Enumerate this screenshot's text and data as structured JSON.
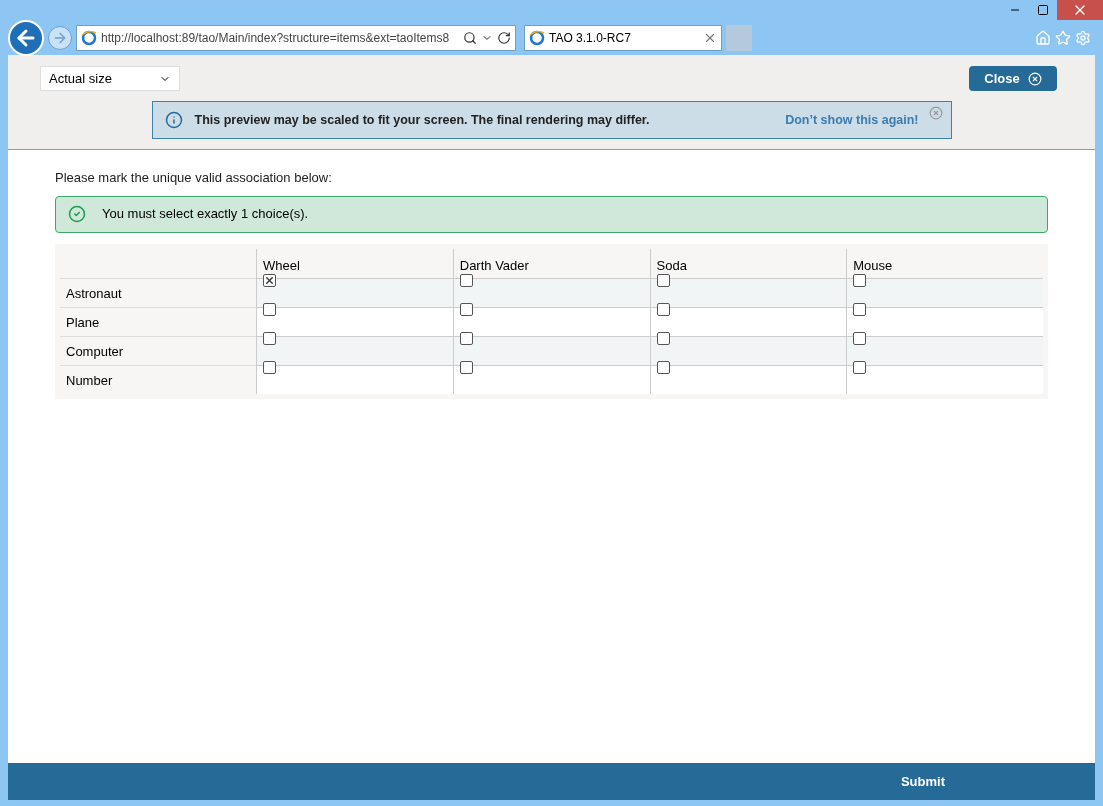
{
  "browser": {
    "url": "http://localhost:89/tao/Main/index?structure=items&ext=taoItems8",
    "tab_title": "TAO 3.1.0-RC7"
  },
  "toolbar": {
    "size_select": "Actual size",
    "close": "Close"
  },
  "notice": {
    "text": "This preview may be scaled to fit your screen. The final rendering may differ.",
    "link": "Don’t show this again!"
  },
  "prompt": "Please mark the unique valid association below:",
  "feedback": "You must select exactly 1 choice(s).",
  "matrix": {
    "columns": [
      "Wheel",
      "Darth Vader",
      "Soda",
      "Mouse"
    ],
    "rows": [
      {
        "label": "Astronaut",
        "cells": [
          {
            "checked": true
          },
          {
            "checked": false
          },
          {
            "checked": false
          },
          {
            "checked": false
          }
        ]
      },
      {
        "label": "Plane",
        "cells": [
          {
            "checked": false
          },
          {
            "checked": false
          },
          {
            "checked": false
          },
          {
            "checked": false
          }
        ]
      },
      {
        "label": "Computer",
        "cells": [
          {
            "checked": false
          },
          {
            "checked": false
          },
          {
            "checked": false
          },
          {
            "checked": false
          }
        ]
      },
      {
        "label": "Number",
        "cells": [
          {
            "checked": false
          },
          {
            "checked": false
          },
          {
            "checked": false
          },
          {
            "checked": false
          }
        ]
      }
    ]
  },
  "footer": {
    "submit": "Submit"
  }
}
